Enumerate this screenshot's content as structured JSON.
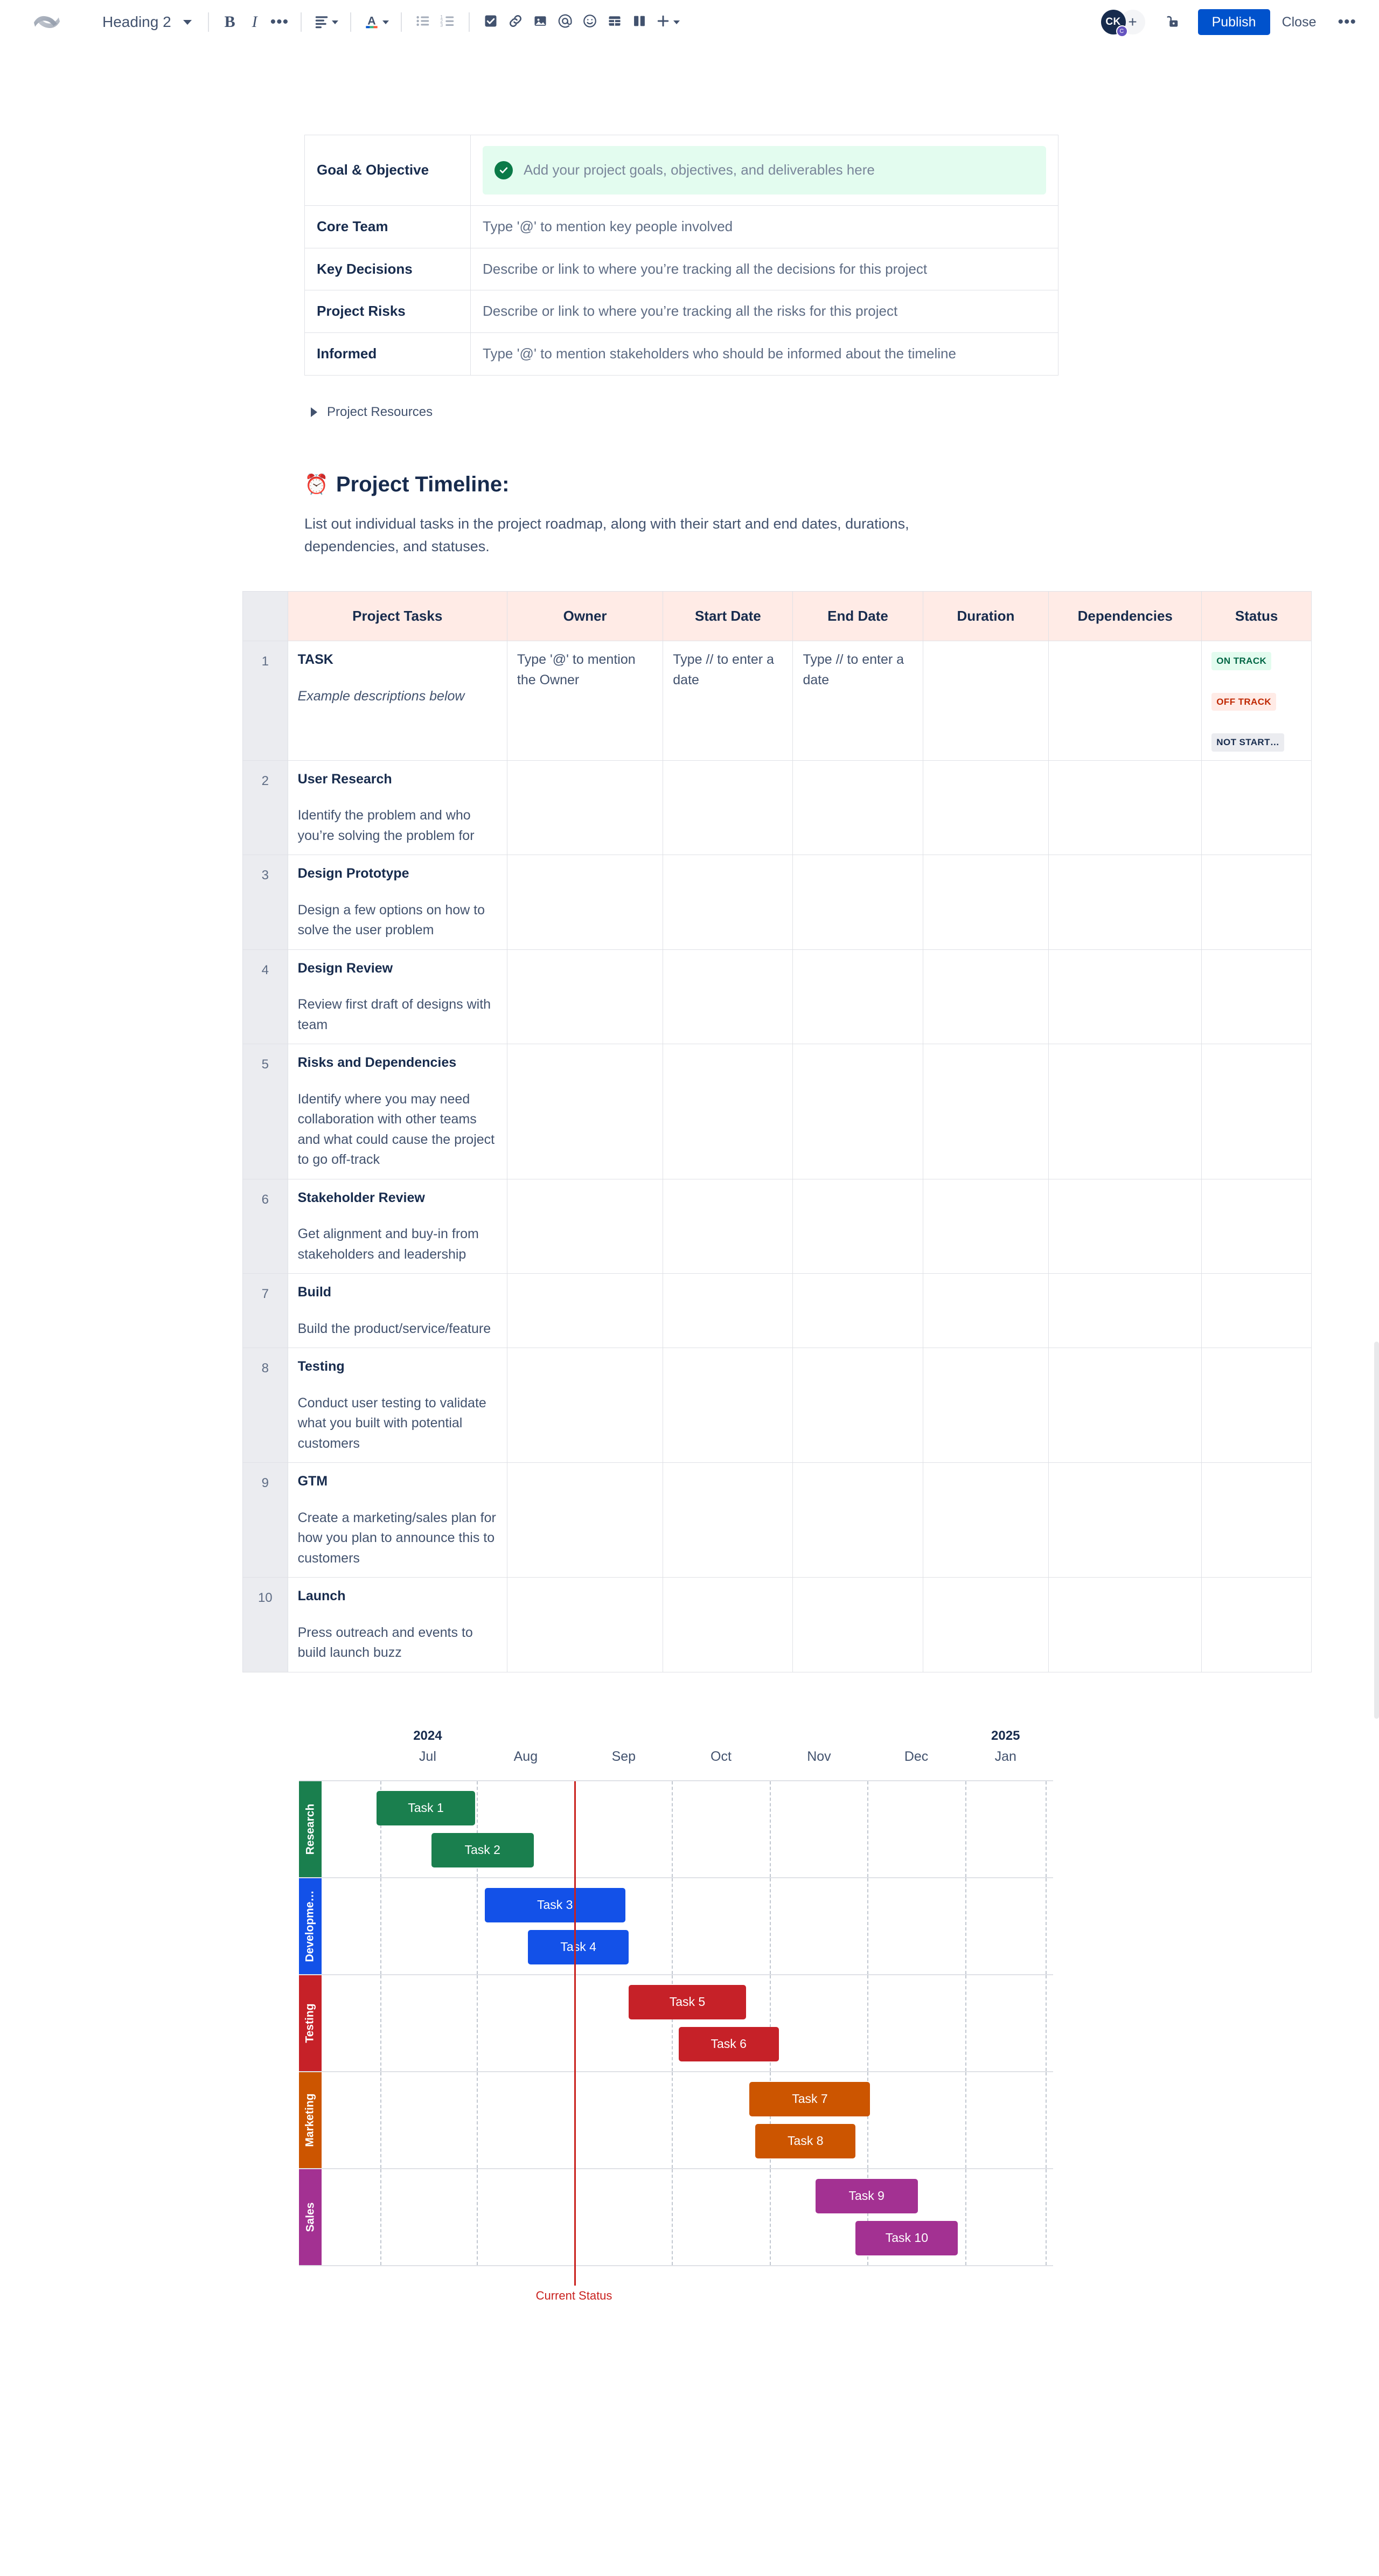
{
  "toolbar": {
    "logo_icon": "confluence-logo",
    "style_select": {
      "value": "Heading 2",
      "icon": "chevron-down-icon"
    },
    "buttons": [
      {
        "name": "bold",
        "label": "B",
        "icon": "bold-icon"
      },
      {
        "name": "italic",
        "label": "I",
        "icon": "italic-icon"
      },
      {
        "name": "more-formatting",
        "label": "•••",
        "icon": "ellipsis-icon"
      },
      {
        "name": "text-align",
        "label": "",
        "icon": "align-left-icon"
      },
      {
        "name": "text-color",
        "label": "A",
        "icon": "text-color-icon"
      },
      {
        "name": "bulleted-list",
        "label": "",
        "icon": "bulleted-list-icon"
      },
      {
        "name": "numbered-list",
        "label": "",
        "icon": "numbered-list-icon"
      },
      {
        "name": "task-list",
        "label": "",
        "icon": "checkbox-icon"
      },
      {
        "name": "insert-link",
        "label": "",
        "icon": "link-icon"
      },
      {
        "name": "insert-image",
        "label": "",
        "icon": "image-icon"
      },
      {
        "name": "mention",
        "label": "@",
        "icon": "mention-icon"
      },
      {
        "name": "emoji",
        "label": "",
        "icon": "emoji-icon"
      },
      {
        "name": "insert-table",
        "label": "",
        "icon": "table-icon"
      },
      {
        "name": "layouts",
        "label": "",
        "icon": "layout-columns-icon"
      },
      {
        "name": "insert-more",
        "label": "+",
        "icon": "plus-icon"
      }
    ],
    "avatar": {
      "initials": "CK",
      "badge": "C"
    },
    "add_user_label": "+",
    "restrictions_icon": "unlock-icon",
    "publish_label": "Publish",
    "close_label": "Close",
    "more_actions_label": "•••",
    "accent_color": "#0052CC"
  },
  "info_table": {
    "rows": [
      {
        "label": "Goal & Objective",
        "value": "Add your project goals, objectives, and deliverables here",
        "panel": true,
        "panel_color": "#E3FCEF",
        "icon": "check-circle-icon"
      },
      {
        "label": "Core Team",
        "value": "Type '@' to mention key people involved",
        "panel": false
      },
      {
        "label": "Key Decisions",
        "value": "Describe or link to where you’re tracking all the decisions for this project",
        "panel": false
      },
      {
        "label": "Project Risks",
        "value": "Describe or link to where you’re tracking all the risks for this project",
        "panel": false
      },
      {
        "label": "Informed",
        "value": "Type '@' to mention stakeholders who should be informed about the timeline",
        "panel": false
      }
    ]
  },
  "expand": {
    "label": "Project Resources",
    "icon": "chevron-right-icon"
  },
  "timeline_section": {
    "emoji": "⏰",
    "heading": "Project Timeline:",
    "description": "List out individual tasks in the project roadmap, along with their start and end dates, durations, dependencies, and statuses."
  },
  "task_table": {
    "headers": [
      "Project Tasks",
      "Owner",
      "Start Date",
      "End Date",
      "Duration",
      "Dependencies",
      "Status"
    ],
    "placeholders": {
      "owner": "Type '@' to mention the Owner",
      "start_date": "Type // to enter a date",
      "end_date": "Type // to enter a date"
    },
    "lozenges": [
      {
        "label": "ON TRACK",
        "style": "green"
      },
      {
        "label": "OFF TRACK",
        "style": "red"
      },
      {
        "label": "NOT START…",
        "style": "grey"
      }
    ],
    "rows": [
      {
        "num": "1",
        "name": "TASK",
        "desc": "Example descriptions below",
        "desc_italic": true,
        "first": true
      },
      {
        "num": "2",
        "name": "User Research",
        "desc": "Identify the problem and who you’re solving the problem for"
      },
      {
        "num": "3",
        "name": "Design Prototype",
        "desc": "Design a few options on how to solve the user problem"
      },
      {
        "num": "4",
        "name": "Design Review",
        "desc": "Review first draft of designs with team"
      },
      {
        "num": "5",
        "name": "Risks and Dependencies",
        "desc": "Identify where you may need collaboration with other teams and what could cause the project to go off-track"
      },
      {
        "num": "6",
        "name": "Stakeholder Review",
        "desc": "Get alignment and buy-in from stakeholders and leadership"
      },
      {
        "num": "7",
        "name": "Build",
        "desc": "Build the product/service/feature"
      },
      {
        "num": "8",
        "name": "Testing",
        "desc": "Conduct user testing to validate what you built with potential customers"
      },
      {
        "num": "9",
        "name": "GTM",
        "desc": "Create a marketing/sales plan for how you plan to announce this to customers"
      },
      {
        "num": "10",
        "name": "Launch",
        "desc": "Press outreach and events to build launch buzz"
      }
    ]
  },
  "chart_data": {
    "type": "bar",
    "chart_kind": "gantt",
    "title": "",
    "xlabel": "",
    "ylabel": "",
    "grid": true,
    "legend": false,
    "axis_years": [
      {
        "label": "2024",
        "pos_pct": 14.5
      },
      {
        "label": "2025",
        "pos_pct": 93.5
      }
    ],
    "categories": [
      "Jul",
      "Aug",
      "Sep",
      "Oct",
      "Nov",
      "Dec",
      "Jan"
    ],
    "tick_positions_pct": [
      14.5,
      27.9,
      41.3,
      54.6,
      68.0,
      81.3,
      93.5
    ],
    "gridline_positions_pct": [
      8.0,
      21.2,
      34.5,
      47.9,
      61.3,
      74.6,
      88.0,
      99.0
    ],
    "lanes": [
      {
        "name": "Research",
        "color": "#1A7F4E",
        "label": "Research"
      },
      {
        "name": "Development",
        "color": "#1351E8",
        "label": "Developme…"
      },
      {
        "name": "Testing",
        "color": "#C62128",
        "label": "Testing"
      },
      {
        "name": "Marketing",
        "color": "#CC5500",
        "label": "Marketing"
      },
      {
        "name": "Sales",
        "color": "#A33192",
        "label": "Sales"
      }
    ],
    "bars": [
      {
        "label": "Task 1",
        "lane": 0,
        "start_pct": 7.5,
        "end_pct": 21.0,
        "row": 0,
        "color": "#1A7F4E"
      },
      {
        "label": "Task 2",
        "lane": 0,
        "start_pct": 15.0,
        "end_pct": 29.0,
        "row": 1,
        "color": "#1A7F4E"
      },
      {
        "label": "Task 3",
        "lane": 1,
        "start_pct": 22.3,
        "end_pct": 41.5,
        "row": 0,
        "color": "#1351E8"
      },
      {
        "label": "Task 4",
        "lane": 1,
        "start_pct": 28.2,
        "end_pct": 42.0,
        "row": 1,
        "color": "#1351E8"
      },
      {
        "label": "Task 5",
        "lane": 2,
        "start_pct": 42.0,
        "end_pct": 58.0,
        "row": 0,
        "color": "#C62128"
      },
      {
        "label": "Task 6",
        "lane": 2,
        "start_pct": 48.8,
        "end_pct": 62.5,
        "row": 1,
        "color": "#C62128"
      },
      {
        "label": "Task 7",
        "lane": 3,
        "start_pct": 58.5,
        "end_pct": 75.0,
        "row": 0,
        "color": "#CC5500"
      },
      {
        "label": "Task 8",
        "lane": 3,
        "start_pct": 59.3,
        "end_pct": 73.0,
        "row": 1,
        "color": "#CC5500"
      },
      {
        "label": "Task 9",
        "lane": 4,
        "start_pct": 67.5,
        "end_pct": 81.5,
        "row": 0,
        "color": "#A33192"
      },
      {
        "label": "Task 10",
        "lane": 4,
        "start_pct": 73.0,
        "end_pct": 87.0,
        "row": 1,
        "color": "#A33192"
      }
    ],
    "marker": {
      "label": "Current Status",
      "pos_pct": 34.5,
      "color": "#C9211E"
    }
  }
}
